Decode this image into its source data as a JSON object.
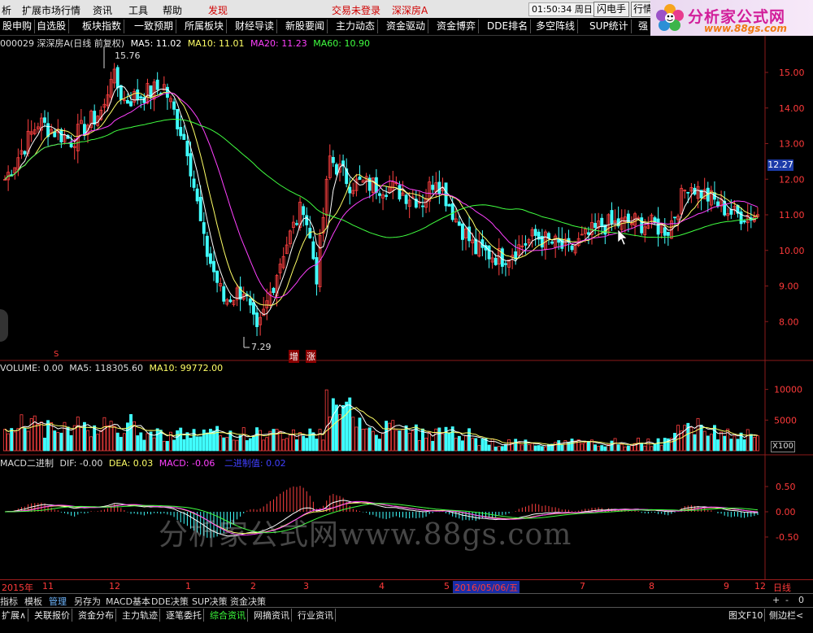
{
  "menubar": {
    "items": [
      "析",
      "扩展市场行情",
      "资讯",
      "工具",
      "帮助",
      "发现"
    ],
    "status": "交易未登录",
    "stock_short": "深深房A",
    "clock": "01:50:34 周日",
    "flash_btn": "闪电手",
    "hq_btn": "行情"
  },
  "logo": {
    "title": "分析家公式网",
    "url": "www.88gs.com"
  },
  "toolbar": {
    "items": [
      "股申购",
      "自选股",
      "板块指数",
      "一致预期",
      "所属板块",
      "财经导读",
      "新股要闻",
      "主力动态",
      "资金驱动",
      "资金博弈",
      "DDE排名",
      "多空阵线",
      "SUP统计",
      "强"
    ]
  },
  "header": {
    "code_name": "000029 深深房A(日线 前复权)",
    "ma5": "MA5: 11.02",
    "ma10": "MA10: 11.01",
    "ma20": "MA20: 11.23",
    "ma60": "MA60: 10.90",
    "high_label": "15.76",
    "low_label": "7.29",
    "price_tag": "12.27",
    "marker_s": "S",
    "marker_zeng": "增",
    "marker_zhang": "涨"
  },
  "volume": {
    "label": "VOLUME: 0.00",
    "ma5": "MA5: 118305.60",
    "ma10": "MA10: 99772.00",
    "unit": "X100"
  },
  "macd": {
    "label": "MACD二进制",
    "dif": "DIF: -0.00",
    "dea": "DEA: 0.03",
    "macd": "MACD: -0.06",
    "bin": "二进制值: 0.02"
  },
  "chart_data": [
    {
      "type": "line",
      "title": "000029 深深房A(日线 前复权)",
      "series": [
        {
          "name": "MA5",
          "value": 11.02
        },
        {
          "name": "MA10",
          "value": 11.01
        },
        {
          "name": "MA20",
          "value": 11.23
        },
        {
          "name": "MA60",
          "value": 10.9
        }
      ],
      "y_ticks": [
        "15.00",
        "14.00",
        "13.00",
        "12.00",
        "11.00",
        "10.00",
        "9.00",
        "8.00"
      ],
      "ylim": [
        7.0,
        15.8
      ],
      "annotations": [
        "15.76",
        "7.29",
        "12.27"
      ]
    },
    {
      "type": "bar",
      "title": "VOLUME",
      "y_ticks": [
        "10000",
        "5000"
      ],
      "series": [
        {
          "name": "MA5",
          "value": 118305.6
        },
        {
          "name": "MA10",
          "value": 99772.0
        }
      ]
    },
    {
      "type": "line",
      "title": "MACD二进制",
      "y_ticks": [
        "0.50",
        "0.00",
        "-0.50"
      ],
      "series": [
        {
          "name": "DIF",
          "value": -0.0
        },
        {
          "name": "DEA",
          "value": 0.03
        },
        {
          "name": "MACD",
          "value": -0.06
        }
      ]
    }
  ],
  "date_axis": {
    "labels": [
      "2015年",
      "11",
      "12",
      "1",
      "2",
      "3",
      "4",
      "5",
      "7",
      "8",
      "9",
      "12"
    ],
    "highlight": "2016/05/06/五",
    "period": "日线"
  },
  "tabs1": {
    "items": [
      "指标",
      "模板",
      "管理",
      "另存为",
      "MACD基本",
      "DDE决策",
      "SUP决策",
      "资金决策"
    ],
    "active": "管理",
    "zoom": [
      "+",
      "-",
      "0"
    ]
  },
  "tabs2": {
    "items": [
      "扩展∧",
      "关联报价",
      "资金分布",
      "主力轨迹",
      "逐笔委托",
      "综合资讯",
      "网摘资讯",
      "行业资讯"
    ],
    "active": "综合资讯",
    "right": [
      "图文F10",
      "侧边栏<"
    ]
  },
  "watermark": "分析家公式网www.88gs.com",
  "colors": {
    "ma5": "#ffffff",
    "ma10": "#ffff66",
    "ma20": "#ff40ff",
    "ma60": "#40ff40",
    "up": "#ff4040",
    "down": "#40ffff",
    "grid": "#8b1a1a"
  }
}
